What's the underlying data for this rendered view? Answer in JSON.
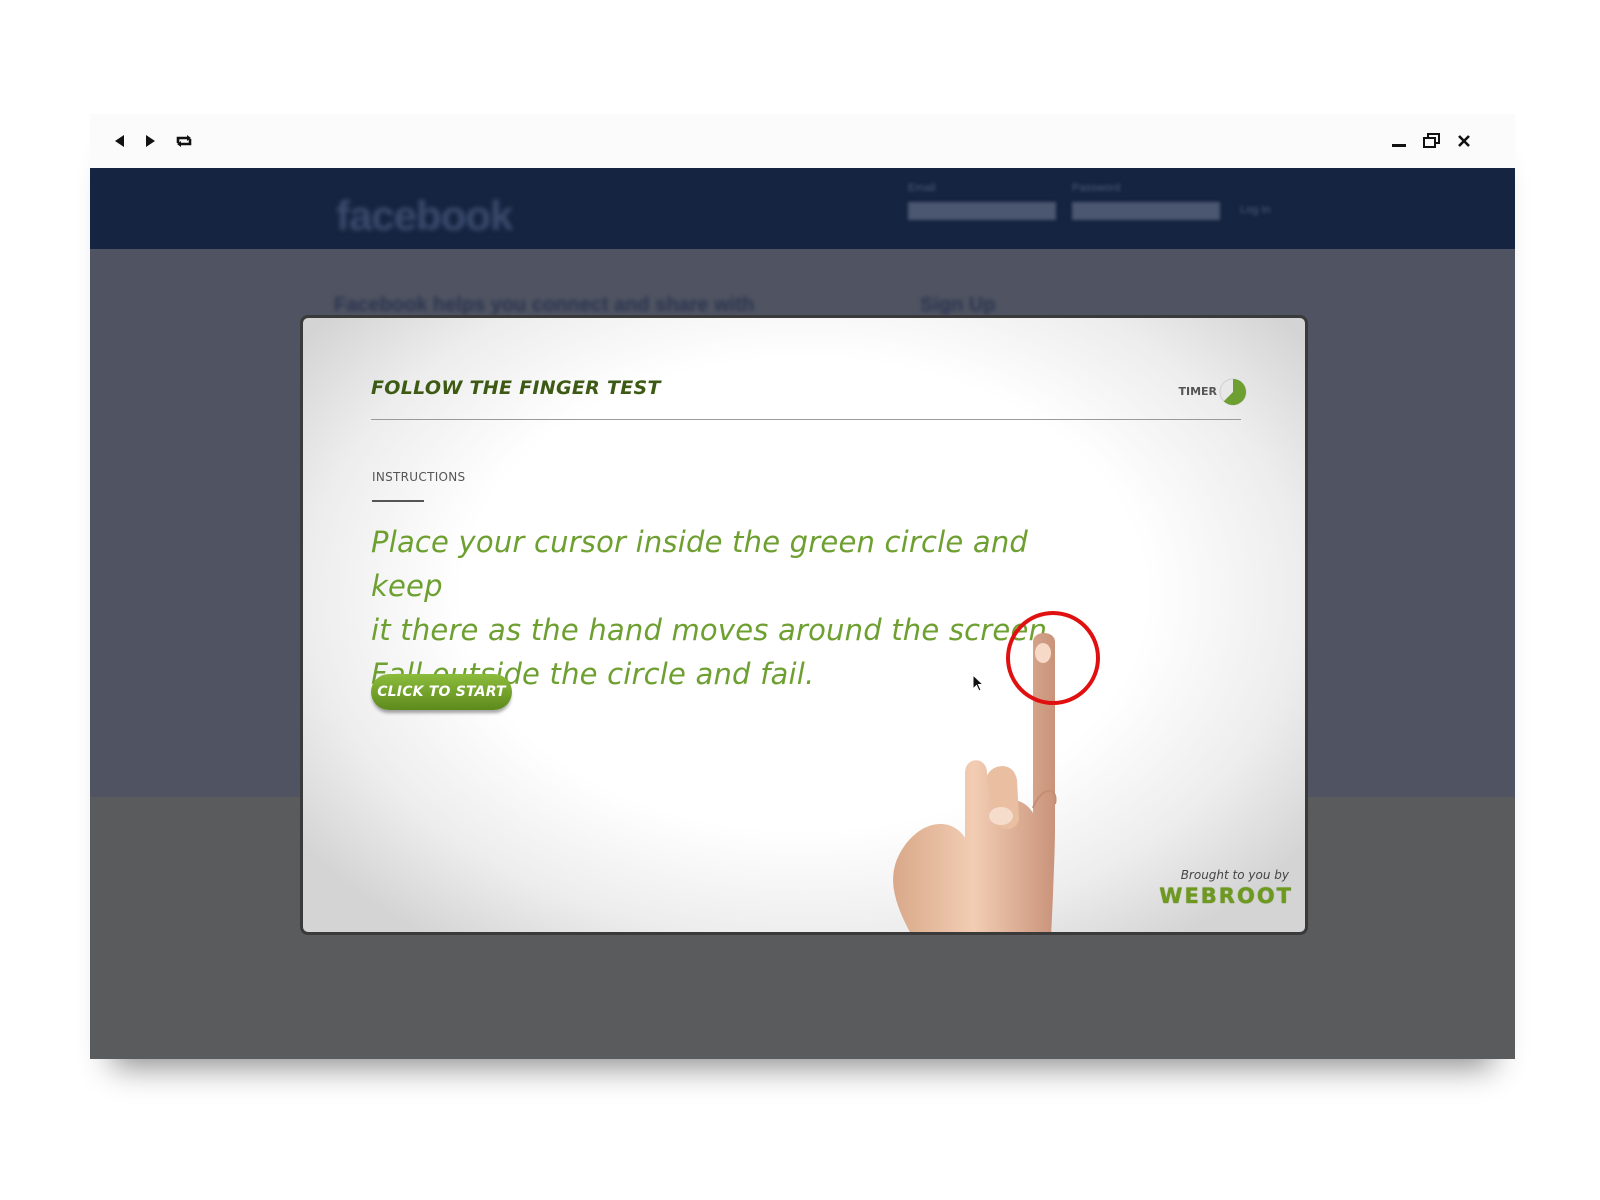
{
  "toolbar": {
    "back_icon": "triangle-left-icon",
    "play_icon": "triangle-right-icon",
    "replay_icon": "loop-icon",
    "minimize_icon": "minimize-icon",
    "restore_icon": "restore-icon",
    "close_icon": "close-icon"
  },
  "background_page": {
    "logo": "facebook",
    "field1_label": "Email",
    "field2_label": "Password",
    "login_label": "Log In",
    "headline": "Facebook helps you connect and share with",
    "signup": "Sign Up"
  },
  "modal": {
    "title": "FOLLOW THE FINGER TEST",
    "timer_label": "TIMER",
    "instructions_label": "INSTRUCTIONS",
    "instructions_lines": [
      "Place your cursor inside the green circle and keep",
      "it there as the hand moves around the screen.",
      "Fall outside the circle and fail."
    ],
    "start_button": "CLICK TO START",
    "brought_by": "Brought to you by",
    "brand": "WEBROOT"
  },
  "colors": {
    "accent_green": "#6ea031",
    "dark_green": "#3d5a14",
    "target_red": "#e01010",
    "facebook_blue": "#152440"
  }
}
